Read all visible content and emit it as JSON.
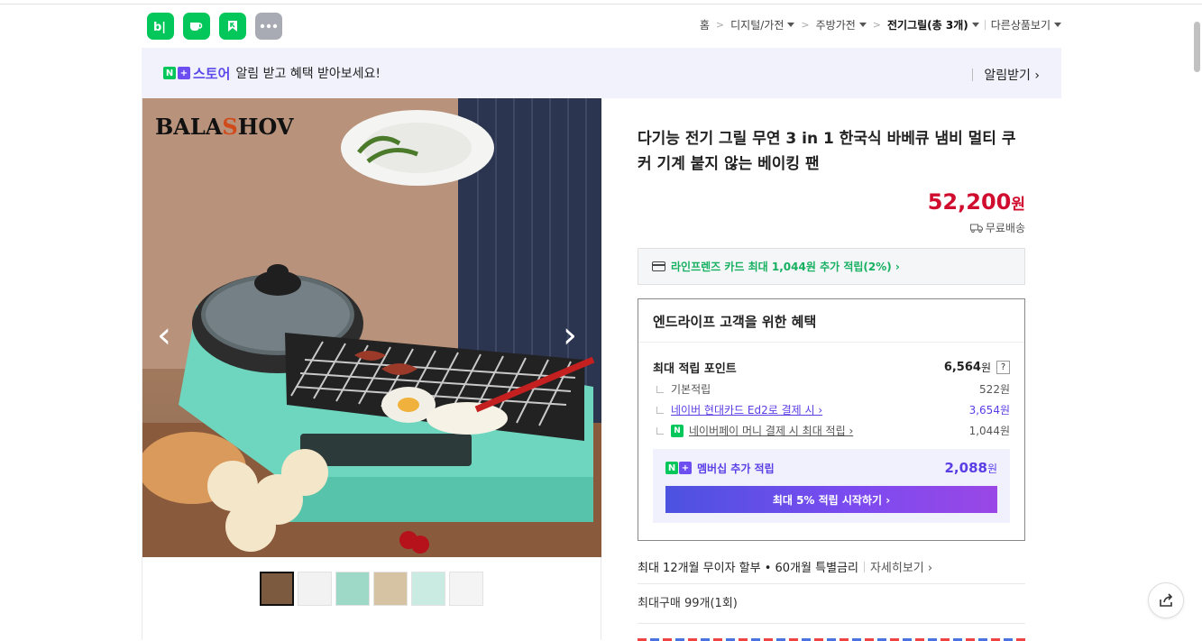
{
  "header": {
    "apps": [
      {
        "name": "blog",
        "glyph": "b|"
      },
      {
        "name": "cafe",
        "glyph": "☕"
      },
      {
        "name": "shopping-bookmark",
        "glyph": "K"
      },
      {
        "name": "more",
        "glyph": "•••"
      }
    ],
    "breadcrumb": {
      "home": "홈",
      "level1": "디지털/가전",
      "level2": "주방가전",
      "current": "전기그릴(총 3개)",
      "other": "다른상품보기"
    }
  },
  "banner": {
    "n_plus": "N+",
    "store": "스토어",
    "message": "알림 받고 혜택 받아보세요!",
    "alarm_label": "알림받기 ›"
  },
  "gallery": {
    "brand": "BALASHOV",
    "prev": "‹",
    "next": "›",
    "thumb_count": 6
  },
  "product": {
    "title": "다기능 전기 그릴 무연 3 in 1 한국식 바베큐 냄비 멀티 쿠커 기계 붙지 않는 베이킹 팬",
    "price": "52,200",
    "price_unit": "원",
    "shipping": "무료배송",
    "card_offer": "라인프렌즈 카드 최대 1,044원 추가 적립(2%) ›"
  },
  "benefit": {
    "heading": "엔드라이프 고객을 위한 혜택",
    "max_points_label": "최대 적립 포인트",
    "max_points_value": "6,564",
    "max_points_unit": "원",
    "help": "?",
    "rows": [
      {
        "label": "기본적립",
        "value": "522원"
      },
      {
        "label": "네이버 현대카드 Ed2로 결제 시 ›",
        "value": "3,654원"
      },
      {
        "label": "네이버페이 머니 결제 시 최대 적립 ›",
        "value": "1,044원"
      }
    ],
    "member_label": "멤버십 추가 적립",
    "member_value": "2,088",
    "member_unit": "원",
    "cta": "최대 5% 적립 시작하기 ›"
  },
  "installment": {
    "text": "최대 12개월 무이자 할부 • 60개월 특별금리",
    "more": "자세히보기 ›"
  },
  "max_purchase": "최대구매 99개(1회)"
}
